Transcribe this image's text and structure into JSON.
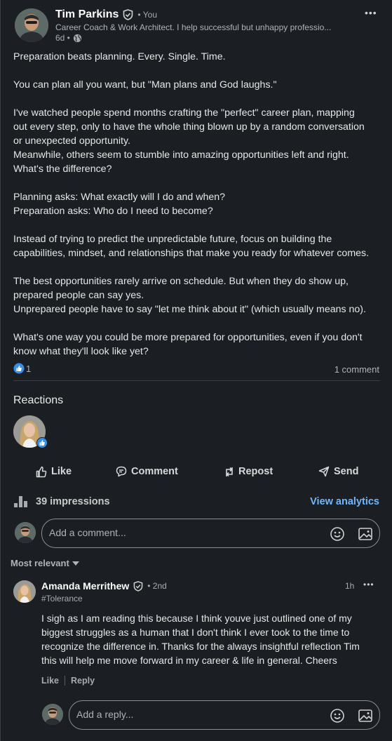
{
  "post": {
    "author": "Tim Parkins",
    "author_suffix": "• You",
    "headline": "Career Coach & Work Architect. I help successful but unhappy professio...",
    "time": "6d •",
    "more": "•••",
    "paragraphs": [
      "Preparation beats planning. Every. Single. Time.",
      "You can plan all you want, but \"Man plans and God laughs.\"",
      "I've watched people spend months crafting the \"perfect\" career plan, mapping\nout every step, only to have the whole thing blown up by a random conversation\nor unexpected opportunity.\nMeanwhile, others seem to stumble into amazing opportunities left and right.\nWhat's the difference?",
      "Planning asks: What exactly will I do and when?\nPreparation asks: Who do I need to become?",
      "Instead of trying to predict the unpredictable future, focus on building the\ncapabilities, mindset, and relationships that make you ready for whatever comes.",
      "The best opportunities rarely arrive on schedule. But when they do show up,\nprepared people can say yes.\nUnprepared people have to say \"let me think about it\" (which usually means no).",
      "What's one way you could be more prepared for opportunities, even if you don't\nknow what they'll look like yet?"
    ],
    "reaction_count": "1",
    "comment_count": "1 comment"
  },
  "reactions": {
    "title": "Reactions"
  },
  "actions": {
    "like": "Like",
    "comment": "Comment",
    "repost": "Repost",
    "send": "Send"
  },
  "analytics": {
    "impressions": "39 impressions",
    "view": "View analytics"
  },
  "comment_input": {
    "placeholder": "Add a comment..."
  },
  "sort": {
    "label": "Most relevant"
  },
  "comment": {
    "author": "Amanda Merrithew",
    "degree": "• 2nd",
    "subtitle": "#Tolerance",
    "time": "1h",
    "more": "•••",
    "text": "I sigh as I am reading this because I think youve just outlined one of my\nbiggest struggles as a human that I don't think I ever took to the time to\nrecognize the difference in. Thanks for the always insightful reflection Tim\nthis will help me move forward in my career & life in general. Cheers",
    "like": "Like",
    "reply": "Reply"
  },
  "reply_input": {
    "placeholder": "Add a reply..."
  },
  "colors": {
    "accent": "#71b7fb",
    "like_blue": "#378fe9",
    "bg": "#1b1f23"
  }
}
